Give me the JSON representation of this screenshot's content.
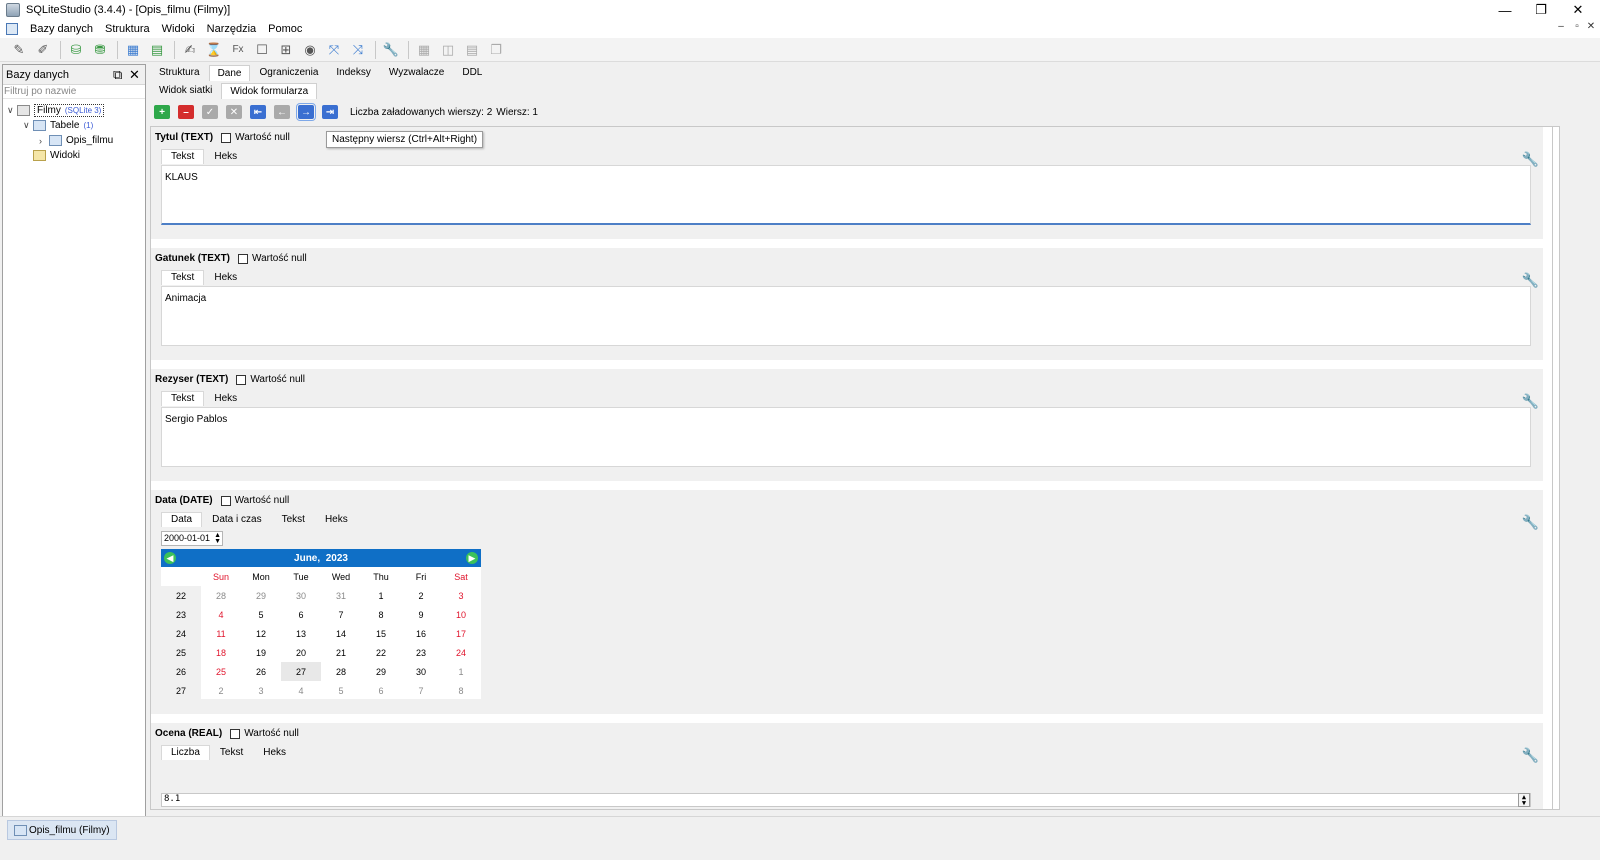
{
  "window": {
    "title": "SQLiteStudio (3.4.4) - [Opis_filmu (Filmy)]",
    "controls": {
      "minimize": "—",
      "maximize": "❐",
      "close": "✕"
    },
    "mdi_controls": {
      "minimize": "–",
      "restore": "▫",
      "close": "✕"
    }
  },
  "menu": [
    "Bazy danych",
    "Struktura",
    "Widoki",
    "Narzędzia",
    "Pomoc"
  ],
  "toolbar": {
    "icons": [
      "connect-icon",
      "disconnect-icon",
      "add-db-icon",
      "remove-db-icon",
      "new-table-icon",
      "new-view-icon",
      "sql-editor-icon",
      "history-icon",
      "functions-icon",
      "collations-icon",
      "extensions-icon",
      "import-icon",
      "export-icon",
      "settings-icon",
      "tile-icon",
      "tile-h-icon",
      "tile-v-icon",
      "cascade-icon"
    ]
  },
  "dock": {
    "title": "Bazy danych",
    "filter_placeholder": "Filtruj po nazwie",
    "tree": {
      "db_name": "Filmy",
      "db_type": "(SQLite 3)",
      "tables_label": "Tabele",
      "tables_count": "(1)",
      "table_name": "Opis_filmu",
      "views_label": "Widoki"
    }
  },
  "tabs": [
    "Struktura",
    "Dane",
    "Ograniczenia",
    "Indeksy",
    "Wyzwalacze",
    "DDL"
  ],
  "subtabs": [
    "Widok siatki",
    "Widok formularza"
  ],
  "actionbar": {
    "rows_loaded_label": "Liczba załadowanych wierszy: 2",
    "row_label": "Wiersz: 1",
    "tooltip": "Następny wiersz (Ctrl+Alt+Right)"
  },
  "fields": {
    "tytul": {
      "label": "Tytul (TEXT)",
      "null_label": "Wartość null",
      "tabs": [
        "Tekst",
        "Heks"
      ],
      "value": "KLAUS"
    },
    "gatunek": {
      "label": "Gatunek (TEXT)",
      "null_label": "Wartość null",
      "tabs": [
        "Tekst",
        "Heks"
      ],
      "value": "Animacja"
    },
    "rezyser": {
      "label": "Rezyser (TEXT)",
      "null_label": "Wartość null",
      "tabs": [
        "Tekst",
        "Heks"
      ],
      "value": "Sergio Pablos"
    },
    "data": {
      "label": "Data (DATE)",
      "null_label": "Wartość null",
      "tabs": [
        "Data",
        "Data i czas",
        "Tekst",
        "Heks"
      ],
      "value": "2000-01-01"
    },
    "ocena": {
      "label": "Ocena (REAL)",
      "null_label": "Wartość null",
      "tabs": [
        "Liczba",
        "Tekst",
        "Heks"
      ],
      "value": "8.1"
    }
  },
  "calendar": {
    "month": "June,",
    "year": "2023",
    "weekdays": [
      "Sun",
      "Mon",
      "Tue",
      "Wed",
      "Thu",
      "Fri",
      "Sat"
    ],
    "weeks": [
      {
        "wk": "22",
        "days": [
          "28",
          "29",
          "30",
          "31",
          "1",
          "2",
          "3"
        ]
      },
      {
        "wk": "23",
        "days": [
          "4",
          "5",
          "6",
          "7",
          "8",
          "9",
          "10"
        ]
      },
      {
        "wk": "24",
        "days": [
          "11",
          "12",
          "13",
          "14",
          "15",
          "16",
          "17"
        ]
      },
      {
        "wk": "25",
        "days": [
          "18",
          "19",
          "20",
          "21",
          "22",
          "23",
          "24"
        ]
      },
      {
        "wk": "26",
        "days": [
          "25",
          "26",
          "27",
          "28",
          "29",
          "30",
          "1"
        ]
      },
      {
        "wk": "27",
        "days": [
          "2",
          "3",
          "4",
          "5",
          "6",
          "7",
          "8"
        ]
      }
    ],
    "selected_day": "27",
    "colors": {
      "header": "#0f6fc6",
      "weekend": "#e0142c",
      "other_month": "#8a8a8a"
    }
  },
  "taskbar": {
    "window_label": "Opis_filmu (Filmy)"
  }
}
